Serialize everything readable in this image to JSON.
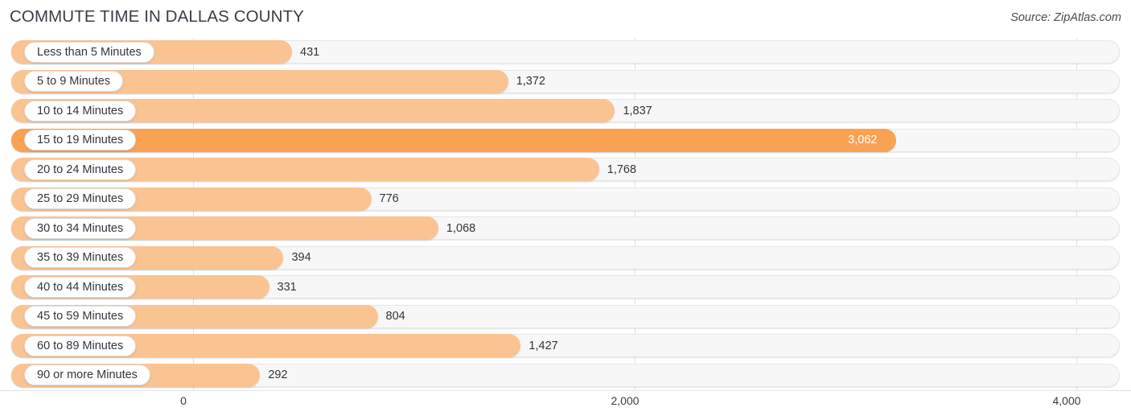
{
  "header": {
    "title": "COMMUTE TIME IN DALLAS COUNTY",
    "source": "Source: ZipAtlas.com"
  },
  "colors": {
    "bar": "#fac392",
    "bar_max": "#f9a254",
    "track": "#f7f7f7",
    "gridline": "#e2e2e4",
    "text": "#33333b"
  },
  "chart_data": {
    "type": "bar",
    "orientation": "horizontal",
    "title": "COMMUTE TIME IN DALLAS COUNTY",
    "subtitle": "",
    "xlabel": "",
    "ylabel": "",
    "xlim": [
      0,
      4000
    ],
    "grid": true,
    "legend": "none",
    "xticks": [
      {
        "value": 0,
        "label": "0"
      },
      {
        "value": 2000,
        "label": "2,000"
      },
      {
        "value": 4000,
        "label": "4,000"
      }
    ],
    "categories": [
      "Less than 5 Minutes",
      "5 to 9 Minutes",
      "10 to 14 Minutes",
      "15 to 19 Minutes",
      "20 to 24 Minutes",
      "25 to 29 Minutes",
      "30 to 34 Minutes",
      "35 to 39 Minutes",
      "40 to 44 Minutes",
      "45 to 59 Minutes",
      "60 to 89 Minutes",
      "90 or more Minutes"
    ],
    "values": [
      431,
      1372,
      1837,
      3062,
      1768,
      776,
      1068,
      394,
      331,
      804,
      1427,
      292
    ],
    "value_labels": [
      "431",
      "1,372",
      "1,837",
      "3,062",
      "1,768",
      "776",
      "1,068",
      "394",
      "331",
      "804",
      "1,427",
      "292"
    ],
    "max_index": 3
  }
}
